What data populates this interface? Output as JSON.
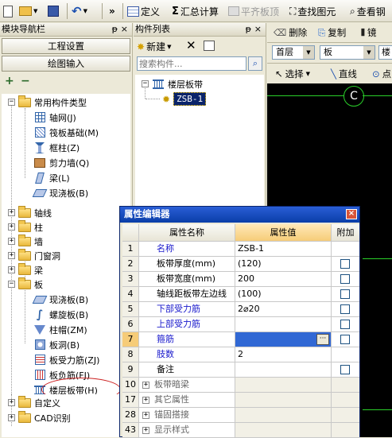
{
  "toolbar": {
    "more_glyph": "»",
    "define_label": "定义",
    "sum_label": "汇总计算",
    "flat_label": "平齐板顶",
    "find_label": "查找图元",
    "view_label": "查看钢"
  },
  "nav_panel": {
    "title": "模块导航栏",
    "pin_glyph": "ᵽ",
    "close_glyph": "×",
    "project_settings": "工程设置",
    "drawing_input": "绘图输入",
    "add_glyph": "+",
    "collapse_glyph": "−",
    "tree": {
      "common": "常用构件类型",
      "axis_grid": "轴网(J)",
      "raft_foundation": "筏板基础(M)",
      "frame_column": "框柱(Z)",
      "shear_wall": "剪力墙(Q)",
      "beam": "梁(L)",
      "cast_slab": "现浇板(B)",
      "axis": "轴线",
      "column": "柱",
      "wall": "墙",
      "door_window": "门窗洞",
      "beam_cat": "梁",
      "slab_cat": "板",
      "slab_cast": "现浇板(B)",
      "spiral_slab": "螺旋板(B)",
      "column_cap": "柱帽(ZM)",
      "slab_hole": "板洞(B)",
      "slab_rebar": "板受力筋(ZJ)",
      "slab_neg_rebar": "板负筋(FJ)",
      "floor_band": "楼层板带(H)",
      "foundation": "基础",
      "other": "其它",
      "custom": "自定义",
      "cad": "CAD识别"
    }
  },
  "component_panel": {
    "title": "构件列表",
    "pin_glyph": "ᵽ",
    "close_glyph": "×",
    "new_label": "新建",
    "delete_glyph": "✕",
    "search_placeholder": "搜索构件...",
    "root": "楼层板带",
    "child": "ZSB-1"
  },
  "draw_toolbar": {
    "delete_label": "删除",
    "copy_label": "复制",
    "mirror_label": "镜",
    "floor_select": "首层",
    "type_select": "板",
    "third_select": "楼",
    "select_label": "选择",
    "line_label": "直线",
    "point_label": "点"
  },
  "canvas": {
    "axis_label": "C"
  },
  "dialog": {
    "title": "属性编辑器",
    "close_glyph": "×",
    "columns": [
      "属性名称",
      "属性值",
      "附加"
    ],
    "rows": [
      {
        "no": "1",
        "name": "名称",
        "value": "ZSB-1"
      },
      {
        "no": "2",
        "name": "板带厚度(mm)",
        "value": "(120)"
      },
      {
        "no": "3",
        "name": "板带宽度(mm)",
        "value": "200"
      },
      {
        "no": "4",
        "name": "轴线距板带左边线",
        "value": "(100)"
      },
      {
        "no": "5",
        "name": "下部受力筋",
        "value": "2⌀20"
      },
      {
        "no": "6",
        "name": "上部受力筋",
        "value": ""
      },
      {
        "no": "7",
        "name": "箍筋",
        "value": ""
      },
      {
        "no": "8",
        "name": "肢数",
        "value": "2"
      },
      {
        "no": "9",
        "name": "备注",
        "value": ""
      },
      {
        "no": "10",
        "name": "板带暗梁",
        "value": ""
      },
      {
        "no": "17",
        "name": "其它属性",
        "value": ""
      },
      {
        "no": "28",
        "name": "锚固搭接",
        "value": ""
      },
      {
        "no": "43",
        "name": "显示样式",
        "value": ""
      }
    ],
    "ellipsis": "···",
    "expand_glyph": "+"
  }
}
